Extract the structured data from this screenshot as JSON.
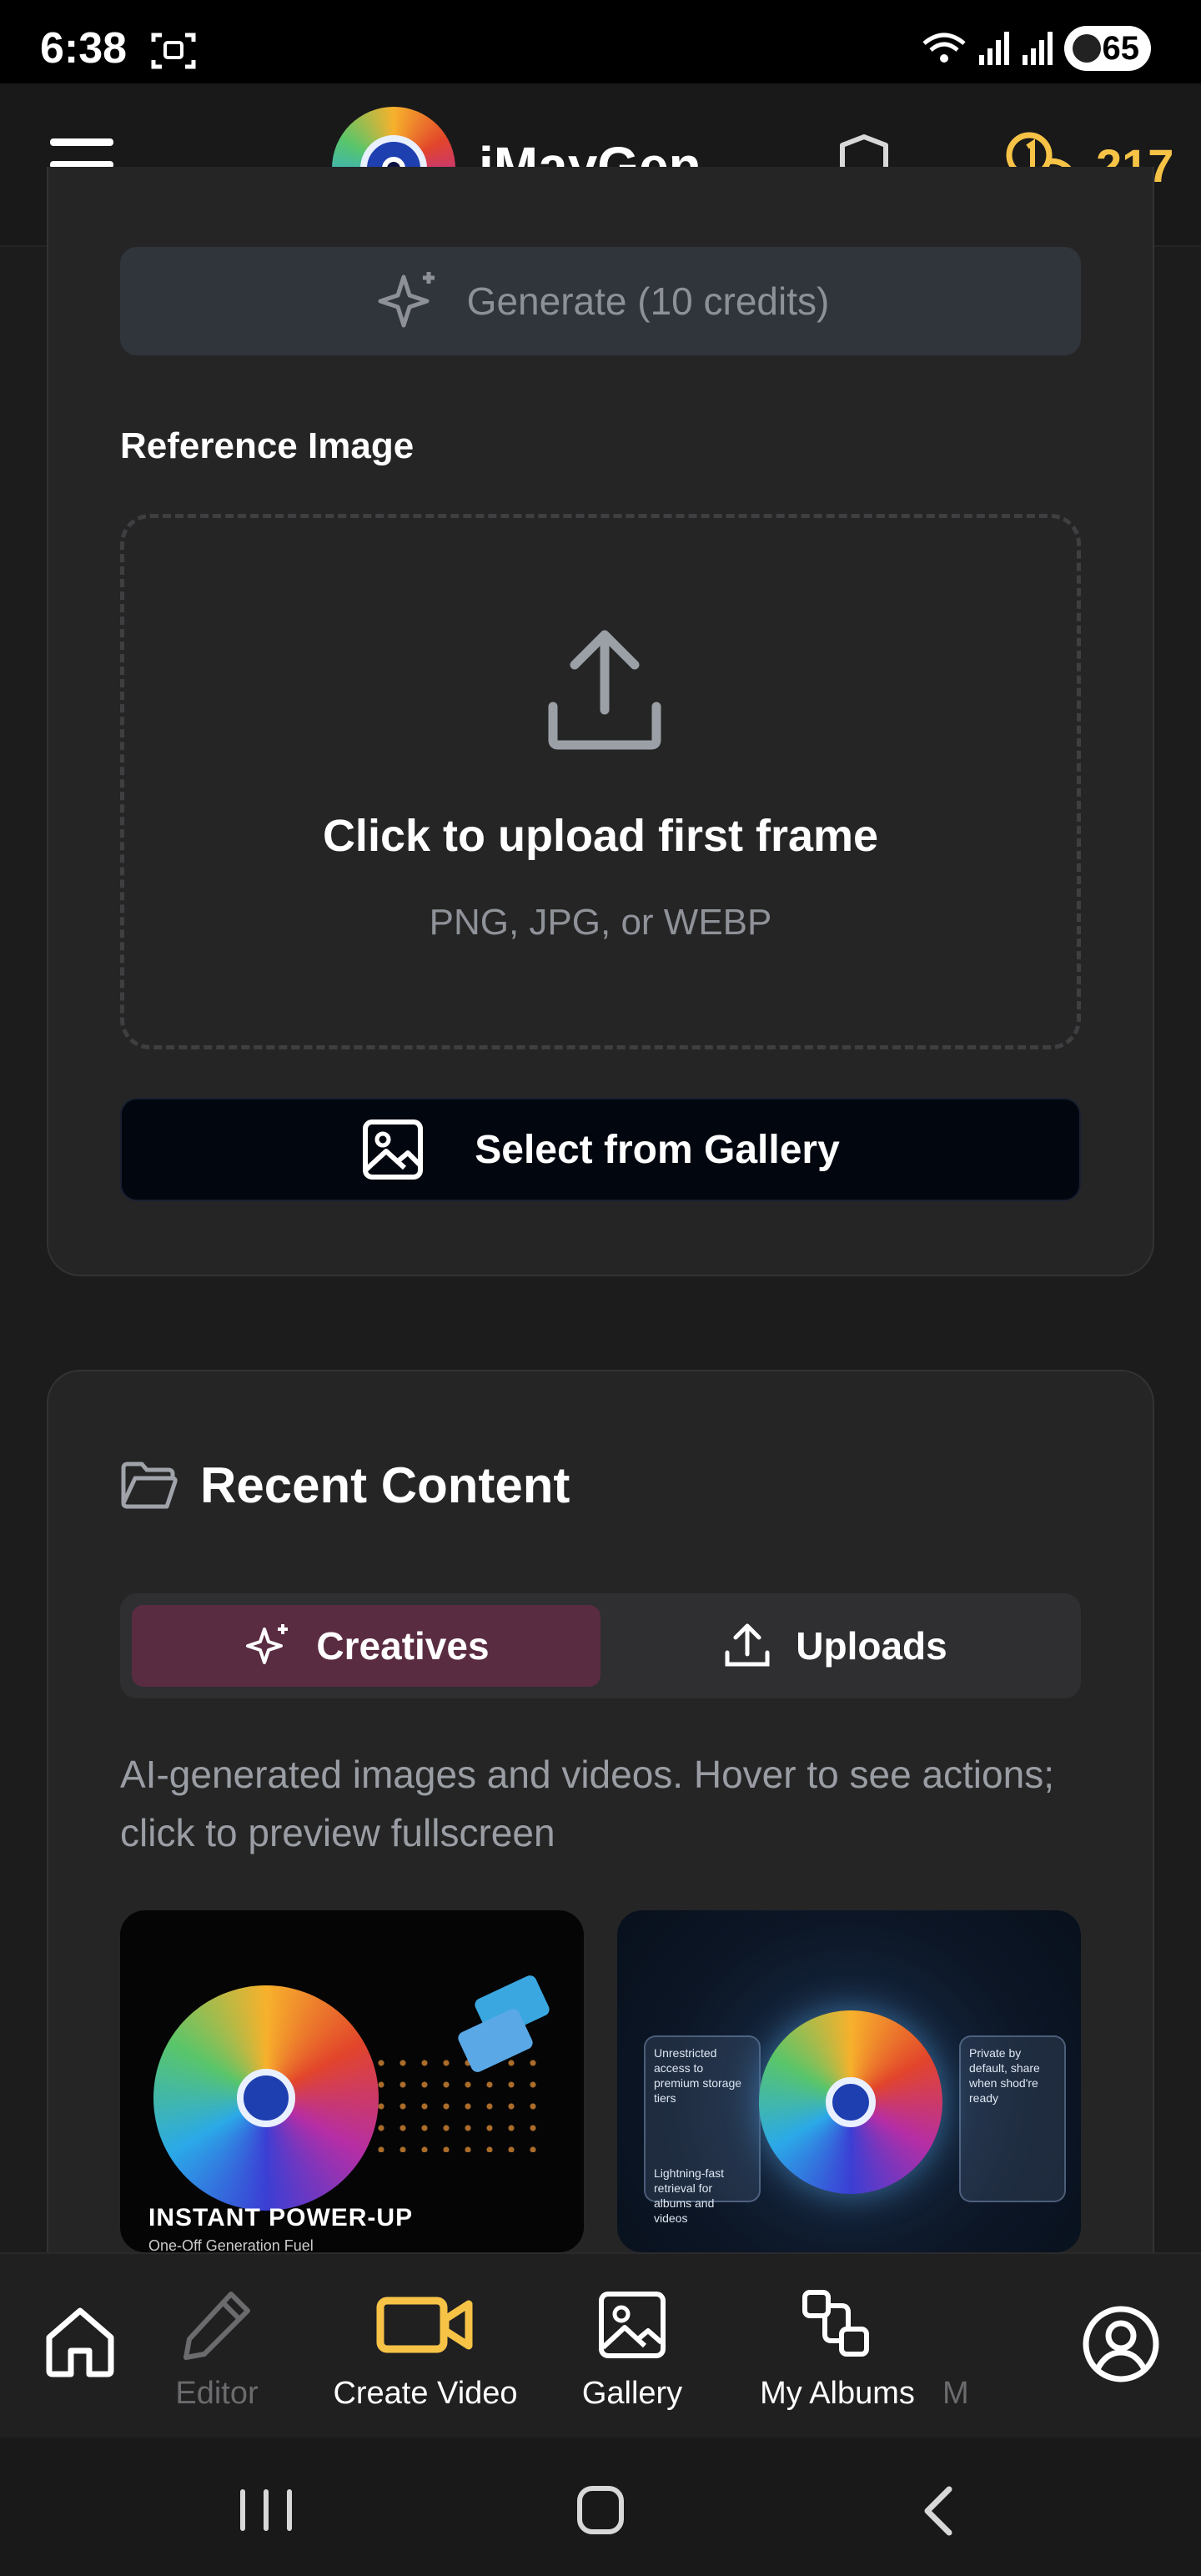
{
  "status_bar": {
    "time": "6:38",
    "battery": "65"
  },
  "header": {
    "brand": "iMayGen",
    "credits": "217",
    "accent_color": "#f6c346"
  },
  "generate": {
    "label": "Generate (10 credits)"
  },
  "reference": {
    "label": "Reference Image",
    "upload_title": "Click to upload first frame",
    "upload_hint": "PNG, JPG, or WEBP",
    "gallery_button": "Select from Gallery"
  },
  "recent": {
    "title": "Recent Content",
    "tabs": [
      {
        "label": "Creatives",
        "active": true,
        "color": "#5a2c42"
      },
      {
        "label": "Uploads",
        "active": false
      }
    ],
    "description": "AI-generated images and videos. Hover to see actions; click to preview fullscreen",
    "items": [
      {
        "caption": "INSTANT POWER-UP",
        "subcaption": "One-Off Generation Fuel"
      },
      {
        "panel_left": "Unrestricted access to premium storage tiers",
        "panel_left_note": "Lightning-fast retrieval for albums and videos",
        "panel_right": "Private by default, share when shod're ready"
      }
    ]
  },
  "bottom_nav": {
    "items": [
      {
        "label": "",
        "icon": "home-icon"
      },
      {
        "label": "Editor",
        "icon": "pencil-icon"
      },
      {
        "label": "Create Video",
        "icon": "video-camera-icon",
        "active": true
      },
      {
        "label": "Gallery",
        "icon": "image-icon"
      },
      {
        "label": "My Albums",
        "icon": "albums-icon"
      },
      {
        "label": "M",
        "icon": ""
      },
      {
        "label": "",
        "icon": "profile-icon"
      }
    ],
    "active_color": "#f6c346"
  }
}
